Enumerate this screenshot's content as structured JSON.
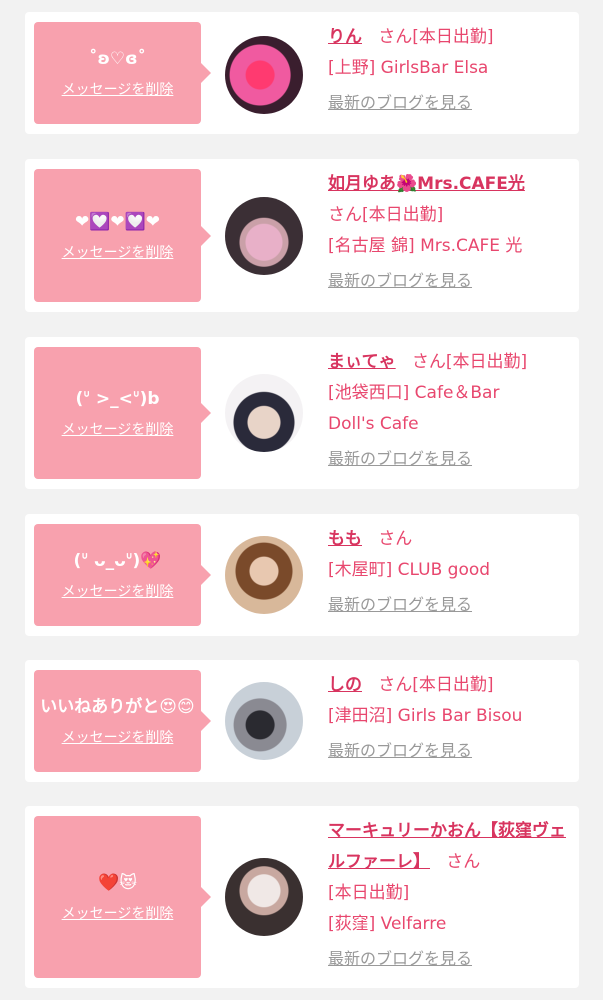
{
  "delete_label": "メッセージを削除",
  "blog_label": "最新のブログを見る",
  "san_label": "さん",
  "cards": [
    {
      "message": "˚ʚ♡ɞ˚",
      "name": "りん",
      "status": "[本日出勤]",
      "shop": "[上野] GirlsBar Elsa",
      "avatar_colors": [
        "#f05aa0",
        "#3a1e2e"
      ]
    },
    {
      "message": "❤💟❤💟❤",
      "name": "如月ゆあ🌺Mrs.CAFE光",
      "status": "[本日出勤]",
      "shop": "[名古屋 錦] Mrs.CAFE 光",
      "avatar_colors": [
        "#3b2f35",
        "#e8b0c8"
      ]
    },
    {
      "message": "(ᐡ >_<ᐡ)b",
      "name": "まぃてゃ",
      "status": "[本日出勤]",
      "shop": "[池袋西口] Cafe＆Bar Doll's Cafe",
      "avatar_colors": [
        "#2a2a3a",
        "#e8d4c8"
      ]
    },
    {
      "message": "(ᐡ ᴗ_ᴗᐡ)💖",
      "name": "もも",
      "status": "",
      "shop": "[木屋町] CLUB good",
      "avatar_colors": [
        "#7a4a2a",
        "#d8b89a"
      ]
    },
    {
      "message": "いいねありがと😍😊",
      "name": "しの",
      "status": "[本日出勤]",
      "shop": "[津田沼] Girls Bar Bisou",
      "avatar_colors": [
        "#c8d0d8",
        "#2a2a30"
      ]
    },
    {
      "message": "❤️😻",
      "name": "マーキュリーかおん【荻窪ヴェルファーレ】",
      "status": "[本日出勤]",
      "shop": "[荻窪] Velfarre",
      "avatar_colors": [
        "#3a3030",
        "#f0e8e6"
      ]
    }
  ]
}
